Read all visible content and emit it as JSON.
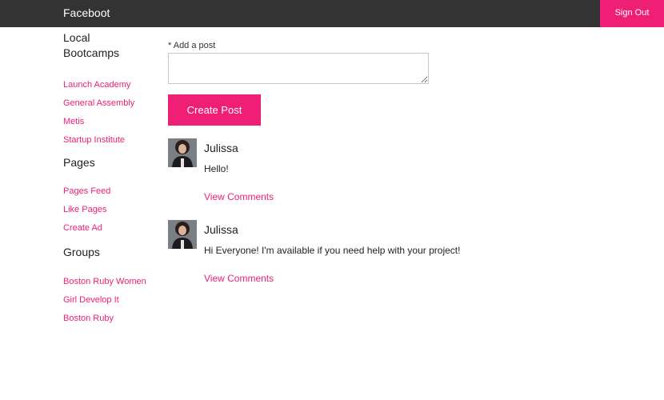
{
  "navbar": {
    "brand": "Faceboot",
    "sign_out": "Sign Out"
  },
  "colors": {
    "accent": "#ee1f75",
    "navbar_bg": "#333333"
  },
  "sidebar": {
    "sections": [
      {
        "title_line1": "Local",
        "title_line2": "Bootcamps",
        "links": [
          "Launch Academy",
          "General Assembly",
          "Metis",
          "Startup Institute"
        ]
      },
      {
        "title": "Pages",
        "links": [
          "Pages Feed",
          "Like Pages",
          "Create Ad"
        ]
      },
      {
        "title": "Groups",
        "links": [
          "Boston Ruby Women",
          "Girl Develop It",
          "Boston Ruby"
        ]
      }
    ]
  },
  "composer": {
    "label": "* Add a post",
    "value": "",
    "button": "Create Post"
  },
  "posts": [
    {
      "author": "Julissa",
      "content": "Hello!",
      "link": "View Comments",
      "avatar_icon": "user-photo"
    },
    {
      "author": "Julissa",
      "content": "Hi Everyone! I'm available if you need help with your project!",
      "link": "View Comments",
      "avatar_icon": "user-photo"
    }
  ]
}
